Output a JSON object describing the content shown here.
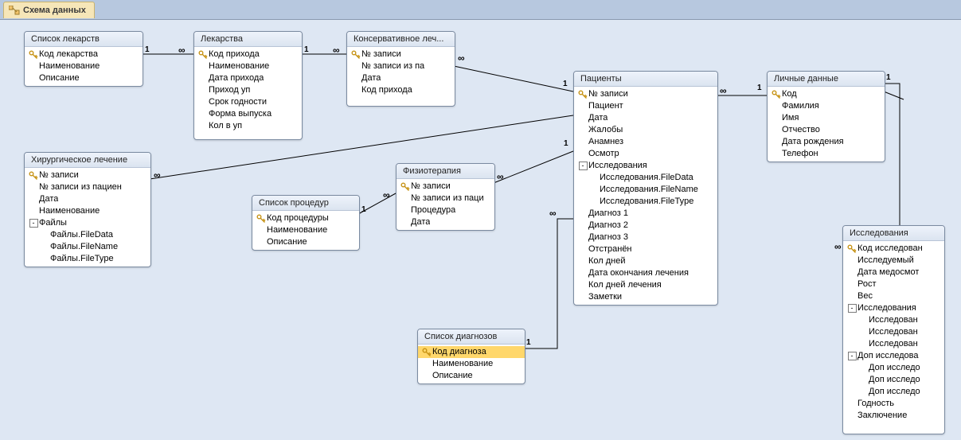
{
  "tab": {
    "label": "Схема данных"
  },
  "rel_labels": {
    "one": "1",
    "many": "∞"
  },
  "tables": {
    "drug_list": {
      "title": "Список лекарств",
      "fields": [
        {
          "key": true,
          "label": "Код лекарства"
        },
        {
          "key": false,
          "label": "Наименование"
        },
        {
          "key": false,
          "label": "Описание"
        }
      ]
    },
    "drugs": {
      "title": "Лекарства",
      "fields": [
        {
          "key": true,
          "label": "Код прихода"
        },
        {
          "key": false,
          "label": "Наименование"
        },
        {
          "key": false,
          "label": "Дата прихода"
        },
        {
          "key": false,
          "label": "Приход уп"
        },
        {
          "key": false,
          "label": "Срок годности"
        },
        {
          "key": false,
          "label": "Форма выпуска"
        },
        {
          "key": false,
          "label": "Кол в уп"
        }
      ]
    },
    "cons_treat": {
      "title": "Консервативное леч...",
      "fields": [
        {
          "key": true,
          "label": "№ записи"
        },
        {
          "key": false,
          "label": "№ записи из па"
        },
        {
          "key": false,
          "label": "Дата"
        },
        {
          "key": false,
          "label": "Код прихода"
        }
      ]
    },
    "surg_treat": {
      "title": "Хирургическое лечение",
      "fields": [
        {
          "key": true,
          "label": "№ записи"
        },
        {
          "key": false,
          "label": "№ записи из пациен"
        },
        {
          "key": false,
          "label": "Дата"
        },
        {
          "key": false,
          "label": "Наименование"
        },
        {
          "expand": "-",
          "label": "Файлы"
        },
        {
          "indent": 2,
          "label": "Файлы.FileData"
        },
        {
          "indent": 2,
          "label": "Файлы.FileName"
        },
        {
          "indent": 2,
          "label": "Файлы.FileType"
        }
      ]
    },
    "proc_list": {
      "title": "Список процедур",
      "fields": [
        {
          "key": true,
          "label": "Код процедуры"
        },
        {
          "key": false,
          "label": "Наименование"
        },
        {
          "key": false,
          "label": "Описание"
        }
      ]
    },
    "physio": {
      "title": "Физиотерапия",
      "fields": [
        {
          "key": true,
          "label": "№ записи"
        },
        {
          "key": false,
          "label": "№ записи из паци"
        },
        {
          "key": false,
          "label": "Процедура"
        },
        {
          "key": false,
          "label": "Дата"
        }
      ]
    },
    "diag_list": {
      "title": "Список диагнозов",
      "fields": [
        {
          "key": true,
          "label": "Код диагноза",
          "selected": true
        },
        {
          "key": false,
          "label": "Наименование"
        },
        {
          "key": false,
          "label": "Описание"
        }
      ]
    },
    "patients": {
      "title": "Пациенты",
      "fields": [
        {
          "key": true,
          "label": "№ записи"
        },
        {
          "key": false,
          "label": "Пациент"
        },
        {
          "key": false,
          "label": "Дата"
        },
        {
          "key": false,
          "label": "Жалобы"
        },
        {
          "key": false,
          "label": "Анамнез"
        },
        {
          "key": false,
          "label": "Осмотр"
        },
        {
          "expand": "-",
          "label": "Исследования"
        },
        {
          "indent": 2,
          "label": "Исследования.FileData"
        },
        {
          "indent": 2,
          "label": "Исследования.FileName"
        },
        {
          "indent": 2,
          "label": "Исследования.FileType"
        },
        {
          "key": false,
          "label": "Диагноз 1"
        },
        {
          "key": false,
          "label": "Диагноз 2"
        },
        {
          "key": false,
          "label": "Диагноз 3"
        },
        {
          "key": false,
          "label": "Отстранён"
        },
        {
          "key": false,
          "label": "Кол дней"
        },
        {
          "key": false,
          "label": "Дата окончания лечения"
        },
        {
          "key": false,
          "label": "Кол дней лечения"
        },
        {
          "key": false,
          "label": "Заметки"
        }
      ]
    },
    "personal": {
      "title": "Личные данные",
      "fields": [
        {
          "key": true,
          "label": "Код"
        },
        {
          "key": false,
          "label": "Фамилия"
        },
        {
          "key": false,
          "label": "Имя"
        },
        {
          "key": false,
          "label": "Отчество"
        },
        {
          "key": false,
          "label": "Дата рождения"
        },
        {
          "key": false,
          "label": "Телефон"
        }
      ]
    },
    "research": {
      "title": "Исследования",
      "fields": [
        {
          "key": true,
          "label": "Код исследован"
        },
        {
          "key": false,
          "label": "Исследуемый"
        },
        {
          "key": false,
          "label": "Дата медосмот"
        },
        {
          "key": false,
          "label": "Рост"
        },
        {
          "key": false,
          "label": "Вес"
        },
        {
          "expand": "-",
          "label": "Исследования"
        },
        {
          "indent": 2,
          "label": "Исследован"
        },
        {
          "indent": 2,
          "label": "Исследован"
        },
        {
          "indent": 2,
          "label": "Исследован"
        },
        {
          "expand": "-",
          "label": "Доп исследова"
        },
        {
          "indent": 2,
          "label": "Доп исследо"
        },
        {
          "indent": 2,
          "label": "Доп исследо"
        },
        {
          "indent": 2,
          "label": "Доп исследо"
        },
        {
          "key": false,
          "label": "Годность"
        },
        {
          "key": false,
          "label": "Заключение"
        }
      ]
    }
  }
}
